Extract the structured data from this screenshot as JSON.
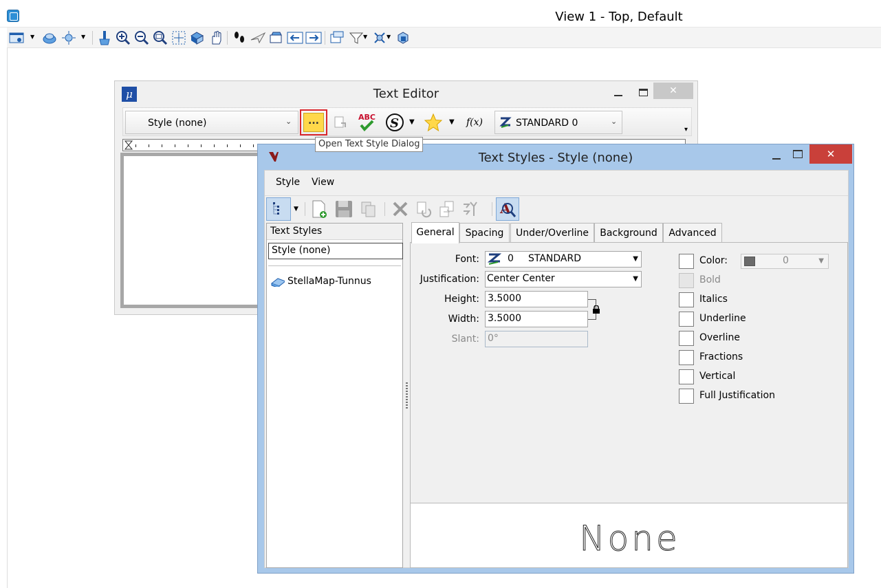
{
  "view_window": {
    "title": "View 1 - Top, Default",
    "toolbar_icons": [
      "view-attributes-icon",
      "display-style-icon",
      "lighting-icon",
      "update-view-icon",
      "zoom-in-icon",
      "zoom-out-icon",
      "window-area-icon",
      "fit-view-icon",
      "rotate-view-icon",
      "pan-view-icon",
      "walk-icon",
      "fly-icon",
      "camera-icon",
      "previous-view-icon",
      "next-view-icon",
      "clip-volume-icon",
      "clip-mask-icon",
      "section-icon",
      "view-box-icon"
    ]
  },
  "text_editor": {
    "title": "Text Editor",
    "style_combo_value": "Style (none)",
    "font_combo_value": "STANDARD 0",
    "tooltip": "Open Text Style Dialog",
    "open_style_button_label": "..."
  },
  "text_styles": {
    "title": "Text Styles - Style (none)",
    "menu": [
      {
        "label": "Style",
        "mnemonic_index": 2
      },
      {
        "label": "View",
        "mnemonic_index": 0
      }
    ],
    "menu_style": "Style",
    "menu_view": "View",
    "left_pane": {
      "header": "Text Styles",
      "selected_style": "Style (none)",
      "library": "StellaMap-Tunnus"
    },
    "tabs": {
      "general": "General",
      "spacing": "Spacing",
      "under_overline": "Under/Overline",
      "background": "Background",
      "advanced": "Advanced"
    },
    "general": {
      "font_label": "Font:",
      "font_number": "0",
      "font_name": "STANDARD",
      "justification_label": "Justification:",
      "justification_value": "Center Center",
      "height_label": "Height:",
      "height_value": "3.5000",
      "width_label": "Width:",
      "width_value": "3.5000",
      "slant_label": "Slant:",
      "slant_value": "0°",
      "color_label": "Color:",
      "color_value": "0",
      "bold_label": "Bold",
      "italics_label": "Italics",
      "underline_label": "Underline",
      "overline_label": "Overline",
      "fractions_label": "Fractions",
      "vertical_label": "Vertical",
      "full_justification_label": "Full Justification"
    },
    "preview_text": "None"
  },
  "colors": {
    "dialog_frame": "#a8c8ea",
    "close_button": "#c9403a",
    "highlight_border": "#d9262c",
    "open_style_fill": "#ffd84a"
  }
}
